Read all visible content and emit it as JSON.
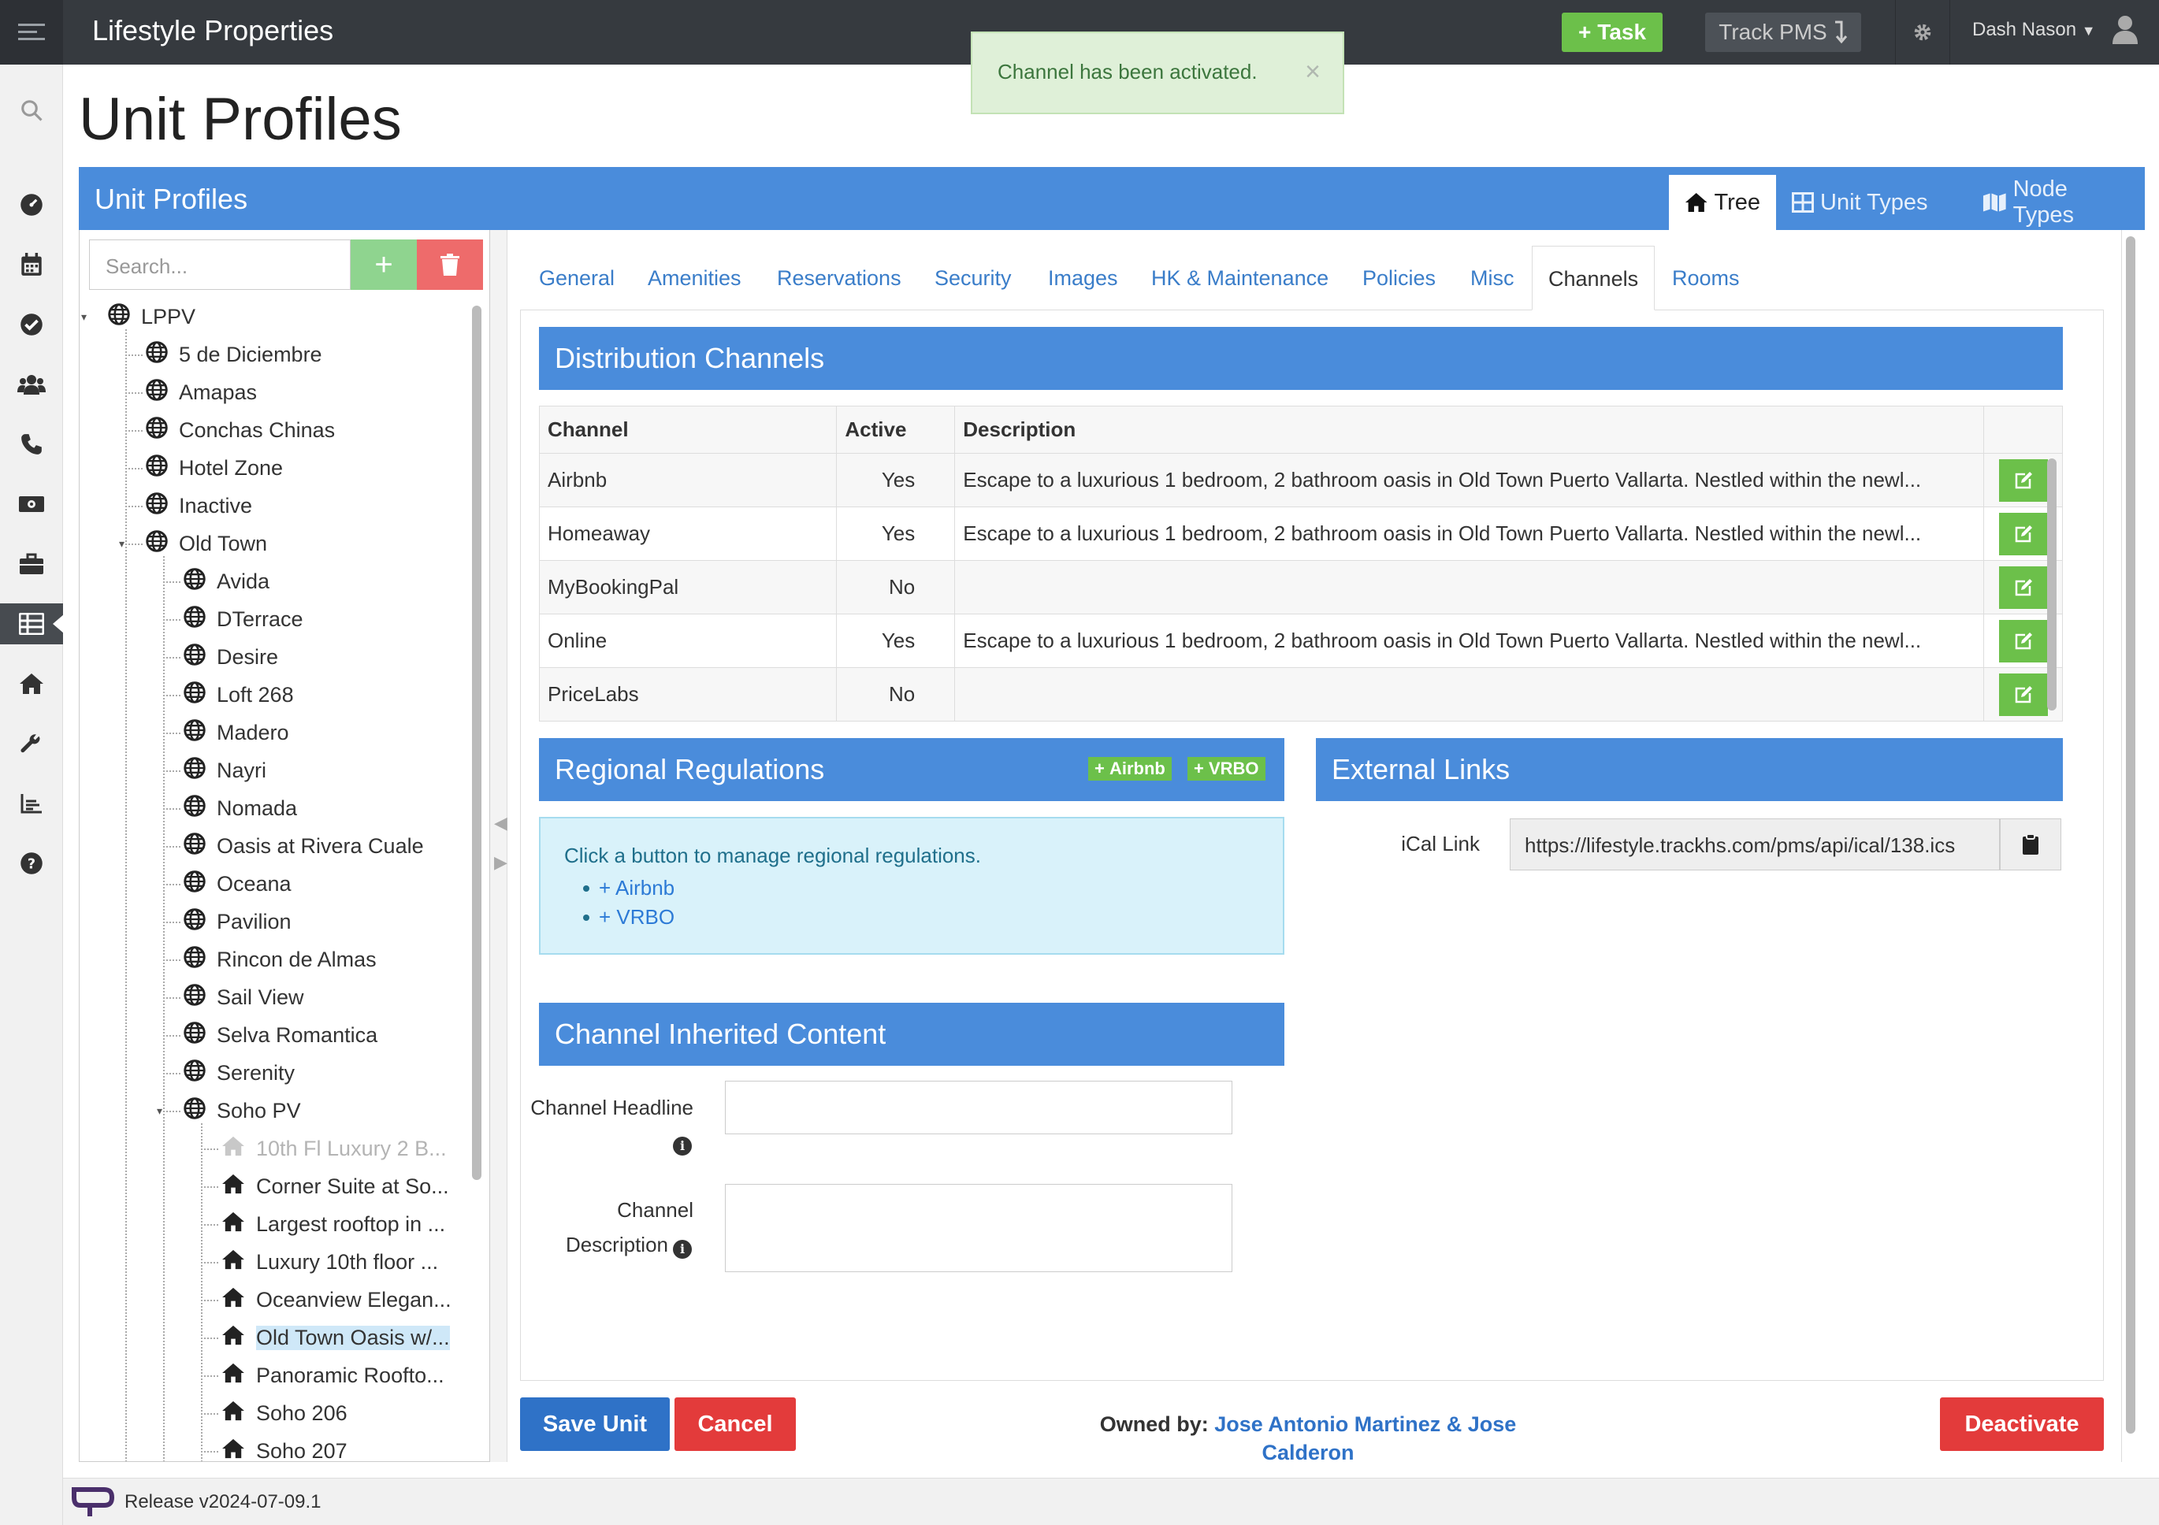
{
  "app": {
    "brand": "Lifestyle Properties"
  },
  "topbar": {
    "task_label": "Task",
    "track_label": "Track PMS",
    "user_name": "Dash Nason"
  },
  "toast": {
    "message": "Channel has been activated."
  },
  "page": {
    "title": "Unit Profiles"
  },
  "panel": {
    "title": "Unit Profiles",
    "view_tabs": [
      {
        "label": "Tree",
        "icon": "home-icon",
        "active": true
      },
      {
        "label": "Unit Types",
        "icon": "grid-icon",
        "active": false
      },
      {
        "label": "Node Types",
        "icon": "map-icon",
        "active": false
      }
    ]
  },
  "tree": {
    "search_placeholder": "Search...",
    "nodes": [
      {
        "label": "LPPV",
        "level": 0,
        "icon": "globe"
      },
      {
        "label": "5 de Diciembre",
        "level": 1,
        "icon": "globe"
      },
      {
        "label": "Amapas",
        "level": 1,
        "icon": "globe"
      },
      {
        "label": "Conchas Chinas",
        "level": 1,
        "icon": "globe"
      },
      {
        "label": "Hotel Zone",
        "level": 1,
        "icon": "globe"
      },
      {
        "label": "Inactive",
        "level": 1,
        "icon": "globe"
      },
      {
        "label": "Old Town",
        "level": 1,
        "icon": "globe"
      },
      {
        "label": "Avida",
        "level": 2,
        "icon": "globe"
      },
      {
        "label": "DTerrace",
        "level": 2,
        "icon": "globe"
      },
      {
        "label": "Desire",
        "level": 2,
        "icon": "globe"
      },
      {
        "label": "Loft 268",
        "level": 2,
        "icon": "globe"
      },
      {
        "label": "Madero",
        "level": 2,
        "icon": "globe"
      },
      {
        "label": "Nayri",
        "level": 2,
        "icon": "globe"
      },
      {
        "label": "Nomada",
        "level": 2,
        "icon": "globe"
      },
      {
        "label": "Oasis at Rivera Cuale",
        "level": 2,
        "icon": "globe"
      },
      {
        "label": "Oceana",
        "level": 2,
        "icon": "globe"
      },
      {
        "label": "Pavilion",
        "level": 2,
        "icon": "globe"
      },
      {
        "label": "Rincon de Almas",
        "level": 2,
        "icon": "globe"
      },
      {
        "label": "Sail View",
        "level": 2,
        "icon": "globe"
      },
      {
        "label": "Selva Romantica",
        "level": 2,
        "icon": "globe"
      },
      {
        "label": "Serenity",
        "level": 2,
        "icon": "globe"
      },
      {
        "label": "Soho PV",
        "level": 2,
        "icon": "globe"
      },
      {
        "label": "10th Fl Luxury 2 B...",
        "level": 3,
        "icon": "home",
        "dim": true
      },
      {
        "label": "Corner Suite at So...",
        "level": 3,
        "icon": "home"
      },
      {
        "label": "Largest rooftop in ...",
        "level": 3,
        "icon": "home"
      },
      {
        "label": "Luxury 10th floor ...",
        "level": 3,
        "icon": "home"
      },
      {
        "label": "Oceanview Elegan...",
        "level": 3,
        "icon": "home"
      },
      {
        "label": "Old Town Oasis w/...",
        "level": 3,
        "icon": "home",
        "selected": true
      },
      {
        "label": "Panoramic Roofto...",
        "level": 3,
        "icon": "home"
      },
      {
        "label": "Soho 206",
        "level": 3,
        "icon": "home"
      },
      {
        "label": "Soho 207",
        "level": 3,
        "icon": "home"
      }
    ]
  },
  "tabs": [
    {
      "label": "General"
    },
    {
      "label": "Amenities"
    },
    {
      "label": "Reservations"
    },
    {
      "label": "Security"
    },
    {
      "label": "Images"
    },
    {
      "label": "HK & Maintenance"
    },
    {
      "label": "Policies"
    },
    {
      "label": "Misc"
    },
    {
      "label": "Channels",
      "active": true
    },
    {
      "label": "Rooms"
    }
  ],
  "distribution": {
    "title": "Distribution Channels",
    "headers": [
      "Channel",
      "Active",
      "Description"
    ],
    "rows": [
      {
        "channel": "Airbnb",
        "active": "Yes",
        "description": "Escape to a luxurious 1 bedroom, 2 bathroom oasis in Old Town Puerto Vallarta. Nestled within the newl..."
      },
      {
        "channel": "Homeaway",
        "active": "Yes",
        "description": "Escape to a luxurious 1 bedroom, 2 bathroom oasis in Old Town Puerto Vallarta. Nestled within the newl..."
      },
      {
        "channel": "MyBookingPal",
        "active": "No",
        "description": ""
      },
      {
        "channel": "Online",
        "active": "Yes",
        "description": "Escape to a luxurious 1 bedroom, 2 bathroom oasis in Old Town Puerto Vallarta. Nestled within the newl..."
      },
      {
        "channel": "PriceLabs",
        "active": "No",
        "description": ""
      }
    ]
  },
  "regional": {
    "title": "Regional Regulations",
    "badge_airbnb": "Airbnb",
    "badge_vrbo": "VRBO",
    "info": "Click a button to manage regional regulations.",
    "links": [
      "Airbnb",
      "VRBO"
    ]
  },
  "external": {
    "title": "External Links",
    "ical_label": "iCal Link",
    "ical_value": "https://lifestyle.trackhs.com/pms/api/ical/138.ics"
  },
  "inherited": {
    "title": "Channel Inherited Content",
    "headline_label": "Channel Headline",
    "description_label_1": "Channel",
    "description_label_2": "Description"
  },
  "footer": {
    "save_label": "Save Unit",
    "cancel_label": "Cancel",
    "deactivate_label": "Deactivate",
    "owned_by_label": "Owned by:",
    "owner_line1": "Jose Antonio Martinez & Jose",
    "owner_line2": "Calderon",
    "release": "Release v2024-07-09.1"
  },
  "colors": {
    "accent": "#4a8cdb",
    "success": "#6cc04a",
    "danger": "#e33b3b",
    "topbar": "#363a3f"
  }
}
